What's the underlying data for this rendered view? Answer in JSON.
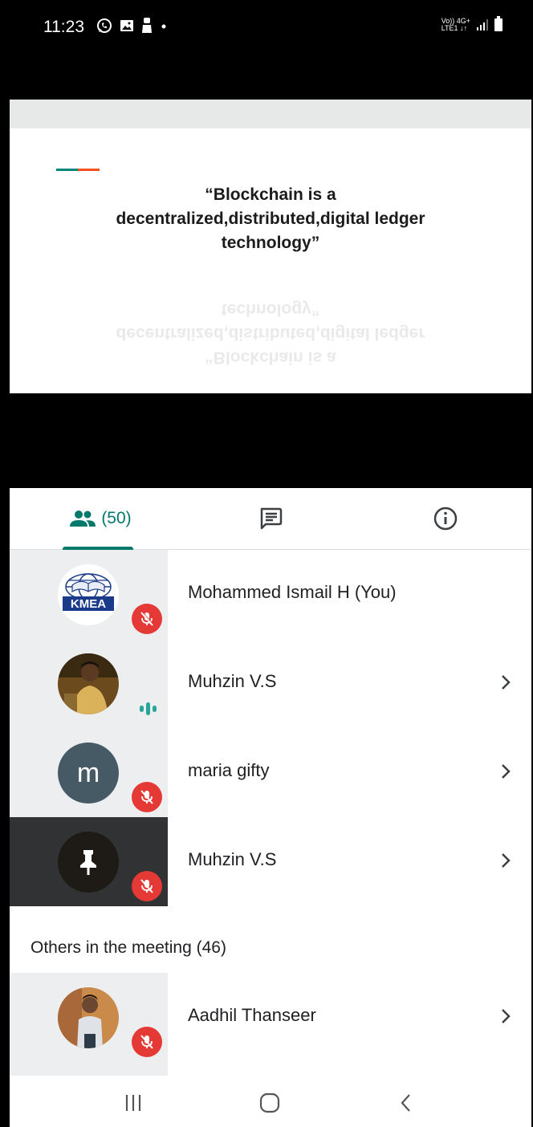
{
  "status_bar": {
    "time": "11:23",
    "network_top": "Vo)) 4G+",
    "network_bottom": "LTE1 ↓↑",
    "icons_left": [
      "whatsapp-icon",
      "gallery-icon",
      "person-icon",
      "dot-icon"
    ],
    "icons_right": [
      "volte-4g-icon",
      "signal-icon",
      "battery-icon"
    ]
  },
  "presentation": {
    "quote": "“Blockchain is a\ndecentralized,distributed,digital ledger\ntechnology”",
    "accent_colors": [
      "#00897b",
      "#f4511e"
    ]
  },
  "tabs": {
    "people_count": "(50)",
    "items": [
      {
        "name": "people",
        "icon": "people-icon",
        "active": true
      },
      {
        "name": "chat",
        "icon": "chat-icon",
        "active": false
      },
      {
        "name": "info",
        "icon": "info-icon",
        "active": false
      }
    ]
  },
  "participants": [
    {
      "name": "Mohammed Ismail H (You)",
      "avatar": "KMEA",
      "muted": true,
      "has_chevron": false
    },
    {
      "name": "Muhzin V.S",
      "avatar": "photo",
      "muted": false,
      "speaking": true,
      "has_chevron": true
    },
    {
      "name": "maria gifty",
      "avatar": "m",
      "muted": true,
      "has_chevron": true
    },
    {
      "name": "Muhzin V.S",
      "avatar": "pinned",
      "muted": true,
      "has_chevron": true
    }
  ],
  "others": {
    "label": "Others in the meeting (46)",
    "items": [
      {
        "name": "Aadhil Thanseer",
        "avatar": "photo",
        "muted": true,
        "has_chevron": true
      }
    ]
  },
  "colors": {
    "accent": "#00796b",
    "muted_badge": "#e53935",
    "speaking": "#26a69a",
    "avatar_letter_bg": "#455a64"
  },
  "navbar": {
    "buttons": [
      "recents-icon",
      "home-icon",
      "back-icon"
    ]
  }
}
